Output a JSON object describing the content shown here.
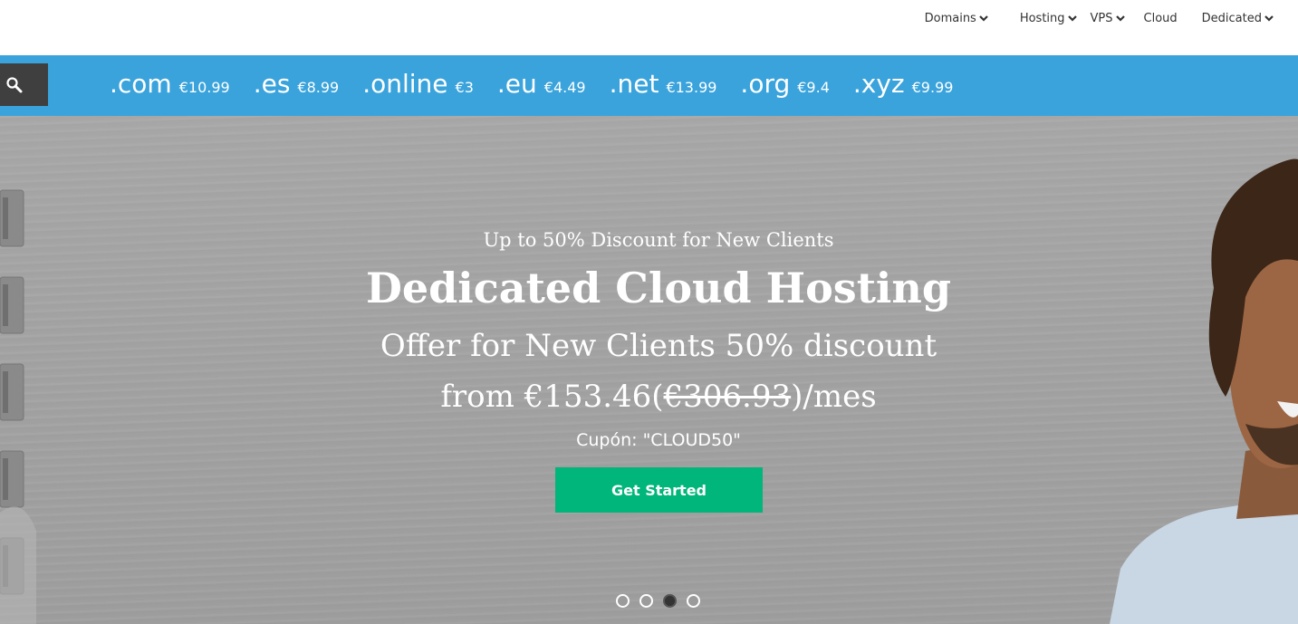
{
  "nav": {
    "items": [
      {
        "label": "Domains",
        "has_dropdown": true
      },
      {
        "label": "Hosting",
        "has_dropdown": true
      },
      {
        "label": "VPS",
        "has_dropdown": true
      },
      {
        "label": "Cloud",
        "has_dropdown": false
      },
      {
        "label": "Dedicated",
        "has_dropdown": true
      }
    ]
  },
  "domain_bar": {
    "search_icon": "search-icon",
    "tlds": [
      {
        "ext": ".com",
        "price": "€10.99"
      },
      {
        "ext": ".es",
        "price": "€8.99"
      },
      {
        "ext": ".online",
        "price": "€3"
      },
      {
        "ext": ".eu",
        "price": "€4.49"
      },
      {
        "ext": ".net",
        "price": "€13.99"
      },
      {
        "ext": ".org",
        "price": "€9.4"
      },
      {
        "ext": ".xyz",
        "price": "€9.99"
      }
    ]
  },
  "hero": {
    "kicker": "Up to 50% Discount for New Clients",
    "headline": "Dedicated Cloud Hosting",
    "offer": "Offer for New Clients 50% discount",
    "price_prefix": "from €153.46(",
    "price_old": "€306.93",
    "price_suffix": ")/mes",
    "coupon": "Cupón: \"CLOUD50\"",
    "cta_label": "Get Started",
    "slides_total": 4,
    "active_slide": 3
  },
  "colors": {
    "domain_bar": "#3aa3dc",
    "search_box": "#3f3f3f",
    "cta": "#00b67a",
    "hero_bg": "#a3a3a3"
  }
}
